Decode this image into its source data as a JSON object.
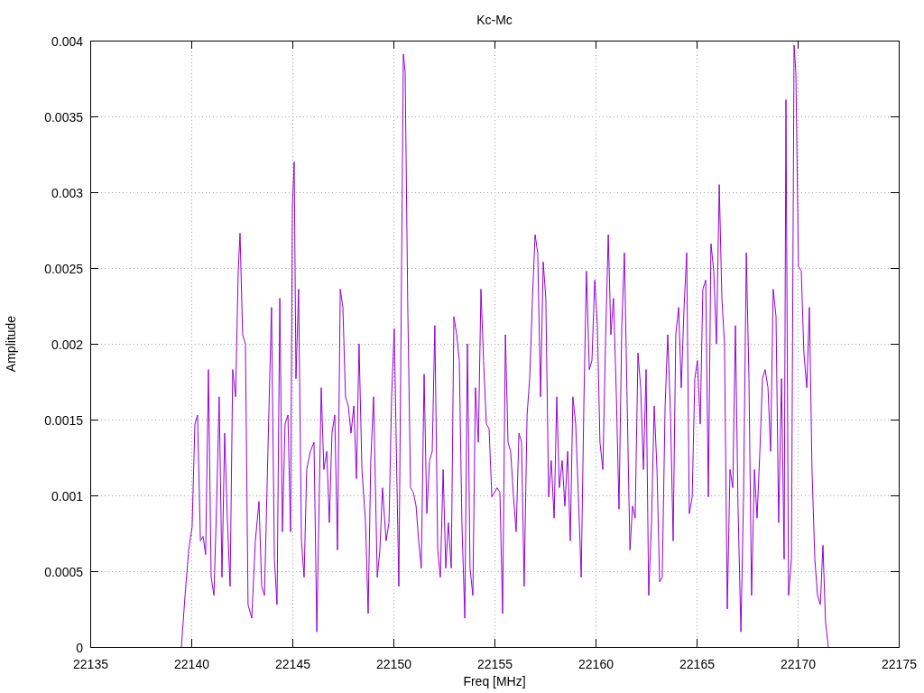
{
  "chart_data": {
    "type": "line",
    "grid": true,
    "title": "Kc-Mc",
    "xlabel": "Freq [MHz]",
    "ylabel": "Amplitude",
    "xlim": [
      22135,
      22175
    ],
    "ylim": [
      0,
      0.004
    ],
    "xticks": [
      22135,
      22140,
      22145,
      22150,
      22155,
      22160,
      22165,
      22170,
      22175
    ],
    "yticks": [
      0,
      0.0005,
      0.001,
      0.0015,
      0.002,
      0.0025,
      0.003,
      0.0035,
      0.004
    ],
    "x": [
      22139.51,
      22139.69,
      22139.87,
      22140.04,
      22140.18,
      22140.31,
      22140.45,
      22140.58,
      22140.71,
      22140.85,
      22140.98,
      22141.12,
      22141.25,
      22141.38,
      22141.52,
      22141.65,
      22141.79,
      22141.92,
      22142.05,
      22142.19,
      22142.32,
      22142.41,
      22142.54,
      22142.68,
      22142.81,
      22142.99,
      22143.17,
      22143.35,
      22143.48,
      22143.62,
      22143.79,
      22143.97,
      22144.11,
      22144.24,
      22144.38,
      22144.51,
      22144.64,
      22144.78,
      22144.91,
      22145.0,
      22145.09,
      22145.18,
      22145.31,
      22145.45,
      22145.58,
      22145.71,
      22145.89,
      22146.07,
      22146.21,
      22146.29,
      22146.43,
      22146.56,
      22146.7,
      22146.83,
      22146.96,
      22147.1,
      22147.23,
      22147.37,
      22147.5,
      22147.63,
      22147.77,
      22147.9,
      22148.04,
      22148.17,
      22148.3,
      22148.44,
      22148.62,
      22148.75,
      22148.88,
      22149.02,
      22149.2,
      22149.33,
      22149.46,
      22149.64,
      22149.78,
      22149.91,
      22150.04,
      22150.18,
      22150.27,
      22150.4,
      22150.49,
      22150.58,
      22150.71,
      22150.85,
      22150.98,
      22151.12,
      22151.25,
      22151.38,
      22151.52,
      22151.65,
      22151.79,
      22151.92,
      22152.05,
      22152.19,
      22152.32,
      22152.46,
      22152.59,
      22152.72,
      22152.86,
      22152.99,
      22153.13,
      22153.26,
      22153.39,
      22153.53,
      22153.66,
      22153.79,
      22153.93,
      22154.06,
      22154.2,
      22154.33,
      22154.46,
      22154.6,
      22154.73,
      22154.87,
      22155.0,
      22155.13,
      22155.27,
      22155.4,
      22155.54,
      22155.67,
      22155.8,
      22155.94,
      22156.07,
      22156.21,
      22156.34,
      22156.47,
      22156.61,
      22156.74,
      22156.88,
      22157.01,
      22157.14,
      22157.28,
      22157.41,
      22157.54,
      22157.68,
      22157.81,
      22157.95,
      22158.08,
      22158.21,
      22158.35,
      22158.48,
      22158.62,
      22158.75,
      22158.88,
      22159.02,
      22159.15,
      22159.29,
      22159.42,
      22159.55,
      22159.69,
      22159.82,
      22159.96,
      22160.09,
      22160.22,
      22160.36,
      22160.49,
      22160.63,
      22160.76,
      22160.89,
      22161.03,
      22161.16,
      22161.3,
      22161.43,
      22161.56,
      22161.7,
      22161.83,
      22161.96,
      22162.1,
      22162.23,
      22162.37,
      22162.5,
      22162.63,
      22162.77,
      22162.9,
      22163.04,
      22163.17,
      22163.3,
      22163.44,
      22163.57,
      22163.71,
      22163.84,
      22163.97,
      22164.11,
      22164.24,
      22164.38,
      22164.51,
      22164.64,
      22164.78,
      22164.91,
      22165.04,
      22165.18,
      22165.31,
      22165.45,
      22165.58,
      22165.71,
      22165.85,
      22165.98,
      22166.12,
      22166.25,
      22166.38,
      22166.52,
      22166.65,
      22166.79,
      22166.92,
      22167.05,
      22167.19,
      22167.32,
      22167.46,
      22167.59,
      22167.72,
      22167.86,
      22167.99,
      22168.13,
      22168.26,
      22168.39,
      22168.53,
      22168.66,
      22168.79,
      22168.93,
      22169.06,
      22169.2,
      22169.33,
      22169.42,
      22169.55,
      22169.69,
      22169.82,
      22169.91,
      22170.04,
      22170.18,
      22170.31,
      22170.45,
      22170.58,
      22170.71,
      22170.85,
      22170.98,
      22171.12,
      22171.25,
      22171.38,
      22171.52
    ],
    "series": [
      {
        "color": "#9400d3",
        "values": [
          0,
          0.00034,
          0.00064,
          0.00079,
          0.00147,
          0.00153,
          0.0007,
          0.00073,
          0.00061,
          0.00183,
          0.00046,
          0.00034,
          0.00093,
          0.00165,
          0.00046,
          0.00141,
          0.00082,
          0.0004,
          0.00183,
          0.00165,
          0.00248,
          0.00273,
          0.00206,
          0.002,
          0.00028,
          0.00019,
          0.0007,
          0.00096,
          0.0004,
          0.00034,
          0.00129,
          0.00224,
          0.00058,
          0.00028,
          0.0023,
          0.00076,
          0.00147,
          0.00153,
          0.00076,
          0.0029,
          0.0032,
          0.00177,
          0.00236,
          0.0007,
          0.00046,
          0.00117,
          0.00129,
          0.00135,
          0.0001,
          0.0007,
          0.00171,
          0.00117,
          0.00129,
          0.00082,
          0.00141,
          0.00153,
          0.00064,
          0.00236,
          0.00224,
          0.00165,
          0.00159,
          0.00141,
          0.00159,
          0.00111,
          0.002,
          0.00117,
          0.00082,
          0.00022,
          0.00123,
          0.00165,
          0.00046,
          0.00064,
          0.00105,
          0.0007,
          0.00082,
          0.00165,
          0.0021,
          0.00105,
          0.0004,
          0.00248,
          0.00391,
          0.00379,
          0.00224,
          0.00105,
          0.00102,
          0.00093,
          0.0007,
          0.00052,
          0.0018,
          0.00088,
          0.00123,
          0.00129,
          0.00212,
          0.00064,
          0.00046,
          0.00117,
          0.00052,
          0.00082,
          0.00052,
          0.00218,
          0.00206,
          0.00189,
          0.00082,
          0.00019,
          0.002,
          0.00052,
          0.00034,
          0.00171,
          0.00135,
          0.00236,
          0.00189,
          0.00147,
          0.00144,
          0.00099,
          0.00102,
          0.00105,
          0.00102,
          0.00022,
          0.00206,
          0.00135,
          0.00129,
          0.00099,
          0.00076,
          0.00141,
          0.00135,
          0.0004,
          0.00153,
          0.00177,
          0.0023,
          0.00272,
          0.0026,
          0.00165,
          0.00254,
          0.0023,
          0.00099,
          0.00123,
          0.00085,
          0.00165,
          0.00105,
          0.00123,
          0.00093,
          0.00129,
          0.0007,
          0.00165,
          0.00147,
          0.00099,
          0.00046,
          0.00159,
          0.00248,
          0.00183,
          0.00189,
          0.00242,
          0.00212,
          0.00135,
          0.00117,
          0.002,
          0.00272,
          0.00206,
          0.0023,
          0.00165,
          0.00091,
          0.00212,
          0.0026,
          0.00165,
          0.00064,
          0.00093,
          0.00085,
          0.00194,
          0.00171,
          0.00117,
          0.00183,
          0.00034,
          0.00082,
          0.00159,
          0.00117,
          0.00043,
          0.00046,
          0.00159,
          0.00206,
          0.00153,
          0.0007,
          0.00206,
          0.00224,
          0.00171,
          0.00224,
          0.0026,
          0.00088,
          0.00099,
          0.00177,
          0.00189,
          0.00147,
          0.00236,
          0.00242,
          0.00099,
          0.00266,
          0.00248,
          0.002,
          0.00305,
          0.0023,
          0.002,
          0.00025,
          0.00117,
          0.00105,
          0.00212,
          0.00093,
          0.0001,
          0.00099,
          0.0026,
          0.00177,
          0.00034,
          0.00117,
          0.00085,
          0.00129,
          0.00177,
          0.00183,
          0.00171,
          0.00129,
          0.00236,
          0.00218,
          0.00082,
          0.00177,
          0.00058,
          0.00361,
          0.00034,
          0.00058,
          0.00397,
          0.00379,
          0.00251,
          0.00248,
          0.00194,
          0.00171,
          0.00224,
          0.00117,
          0.00058,
          0.00034,
          0.00028,
          0.00067,
          0.00016,
          0
        ]
      }
    ]
  }
}
